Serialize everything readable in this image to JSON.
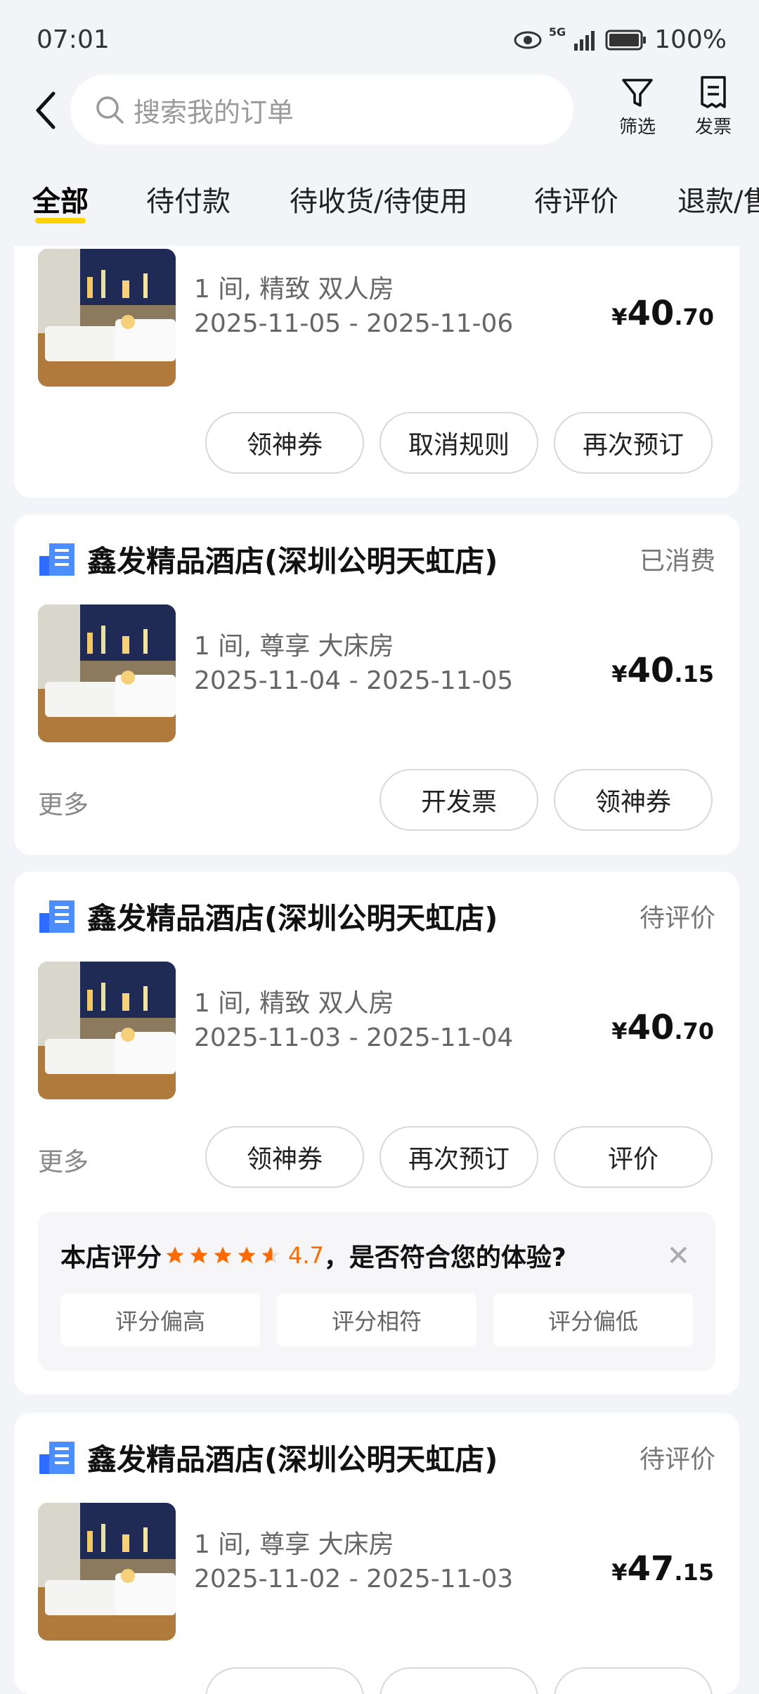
{
  "status_bar": {
    "time": "07:01",
    "signal_label": "5G",
    "battery": "100%"
  },
  "search": {
    "placeholder": "搜索我的订单"
  },
  "header_actions": {
    "filter": "筛选",
    "invoice": "发票"
  },
  "tabs": [
    "全部",
    "待付款",
    "待收货/待使用",
    "待评价",
    "退款/售后"
  ],
  "active_tab_index": 0,
  "orders": [
    {
      "hotel": "",
      "status": "",
      "room": "1 间, 精致 双人房",
      "dates": "2025-11-05 - 2025-11-06",
      "price_symbol": "¥",
      "price_int": "40",
      "price_dec": ".70",
      "more": "",
      "buttons": [
        "领神券",
        "取消规则",
        "再次预订"
      ]
    },
    {
      "hotel": "鑫发精品酒店(深圳公明天虹店)",
      "status": "已消费",
      "room": "1 间, 尊享 大床房",
      "dates": "2025-11-04 - 2025-11-05",
      "price_symbol": "¥",
      "price_int": "40",
      "price_dec": ".15",
      "more": "更多",
      "buttons": [
        "开发票",
        "领神券"
      ]
    },
    {
      "hotel": "鑫发精品酒店(深圳公明天虹店)",
      "status": "待评价",
      "room": "1 间, 精致 双人房",
      "dates": "2025-11-03 - 2025-11-04",
      "price_symbol": "¥",
      "price_int": "40",
      "price_dec": ".70",
      "more": "更多",
      "buttons": [
        "领神券",
        "再次预订",
        "评价"
      ],
      "rating_prompt": {
        "label": "本店评分",
        "score": "4.7",
        "question": "，是否符合您的体验?",
        "stars": 4.7,
        "options": [
          "评分偏高",
          "评分相符",
          "评分偏低"
        ]
      }
    },
    {
      "hotel": "鑫发精品酒店(深圳公明天虹店)",
      "status": "待评价",
      "room": "1 间, 尊享 大床房",
      "dates": "2025-11-02 - 2025-11-03",
      "price_symbol": "¥",
      "price_int": "47",
      "price_dec": ".15",
      "more": "",
      "buttons": []
    }
  ],
  "colors": {
    "accent": "#ffd200",
    "rating": "#ff6a00",
    "hotel_icon": "#2f6bff"
  }
}
